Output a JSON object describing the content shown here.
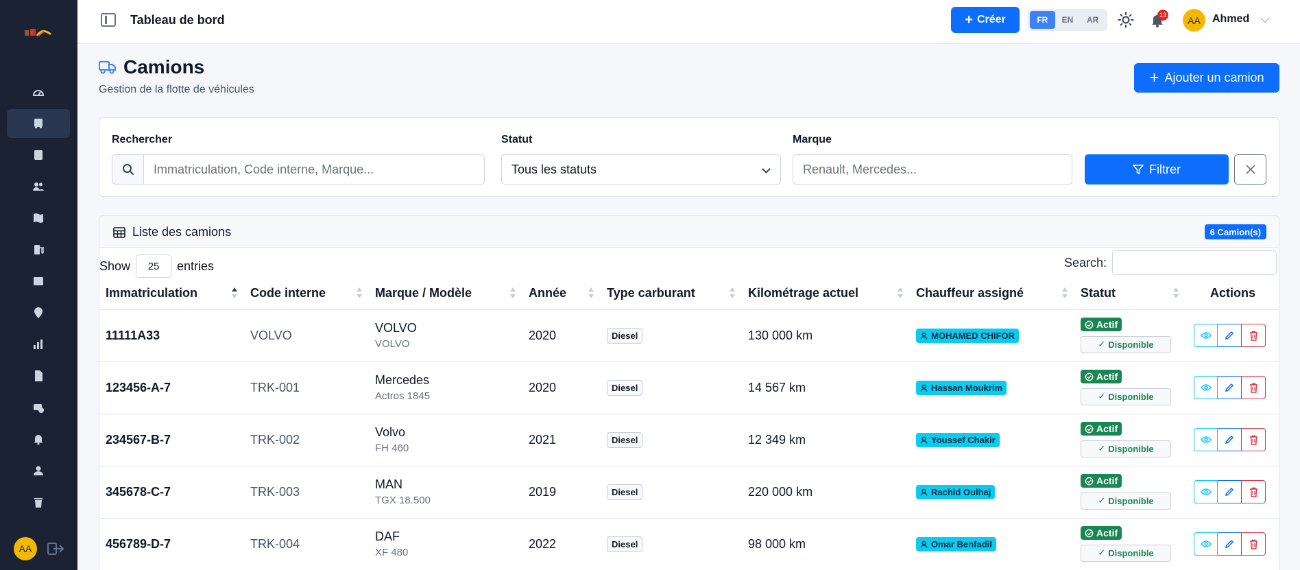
{
  "topbar": {
    "title": "Tableau de bord",
    "create_label": "Créer",
    "languages": [
      "FR",
      "EN",
      "AR"
    ],
    "active_language": "FR",
    "notification_count": "13",
    "user_initials": "AA",
    "user_name": "Ahmed"
  },
  "sidebar": {
    "items": [
      {
        "icon": "gauge-icon"
      },
      {
        "icon": "bus-icon",
        "active": true
      },
      {
        "icon": "contact-card-icon"
      },
      {
        "icon": "users-icon"
      },
      {
        "icon": "map-icon"
      },
      {
        "icon": "fuel-pump-icon"
      },
      {
        "icon": "receipt-icon"
      },
      {
        "icon": "location-pin-icon"
      },
      {
        "icon": "bar-chart-icon"
      },
      {
        "icon": "document-icon"
      },
      {
        "icon": "maintenance-icon"
      },
      {
        "icon": "bell-icon"
      },
      {
        "icon": "user-icon"
      },
      {
        "icon": "trash-icon"
      }
    ],
    "user_initials": "AA"
  },
  "page": {
    "title": "Camions",
    "subtitle": "Gestion de la flotte de véhicules",
    "add_label": "Ajouter un camion"
  },
  "filters": {
    "search_label": "Rechercher",
    "search_placeholder": "Immatriculation, Code interne, Marque...",
    "status_label": "Statut",
    "status_value": "Tous les statuts",
    "brand_label": "Marque",
    "brand_placeholder": "Renault, Mercedes...",
    "filter_label": "Filtrer"
  },
  "table": {
    "title": "Liste des camions",
    "count_badge": "6 Camion(s)",
    "show_label": "Show",
    "entries_value": "25",
    "entries_label": "entries",
    "search_label": "Search:",
    "columns": [
      "Immatriculation",
      "Code interne",
      "Marque / Modèle",
      "Année",
      "Type carburant",
      "Kilométrage actuel",
      "Chauffeur assigné",
      "Statut",
      "Actions"
    ],
    "status_active": "Actif",
    "status_available": "Disponible",
    "rows": [
      {
        "immat": "11111A33",
        "code": "VOLVO",
        "brand": "VOLVO",
        "model": "VOLVO",
        "year": "2020",
        "fuel": "Diesel",
        "km": "130 000 km",
        "driver": "MOHAMED CHIFOR"
      },
      {
        "immat": "123456-A-7",
        "code": "TRK-001",
        "brand": "Mercedes",
        "model": "Actros 1845",
        "year": "2020",
        "fuel": "Diesel",
        "km": "14 567 km",
        "driver": "Hassan Moukrim"
      },
      {
        "immat": "234567-B-7",
        "code": "TRK-002",
        "brand": "Volvo",
        "model": "FH 460",
        "year": "2021",
        "fuel": "Diesel",
        "km": "12 349 km",
        "driver": "Youssef Chakir"
      },
      {
        "immat": "345678-C-7",
        "code": "TRK-003",
        "brand": "MAN",
        "model": "TGX 18.500",
        "year": "2019",
        "fuel": "Diesel",
        "km": "220 000 km",
        "driver": "Rachid Oulhaj"
      },
      {
        "immat": "456789-D-7",
        "code": "TRK-004",
        "brand": "DAF",
        "model": "XF 480",
        "year": "2022",
        "fuel": "Diesel",
        "km": "98 000 km",
        "driver": "Omar Benfadil"
      }
    ]
  },
  "colors": {
    "primary": "#0d6efd",
    "sidebar": "#1a2233",
    "success": "#198754",
    "info": "#0dcaf0",
    "danger": "#dc3545",
    "avatar": "#f5b800"
  }
}
